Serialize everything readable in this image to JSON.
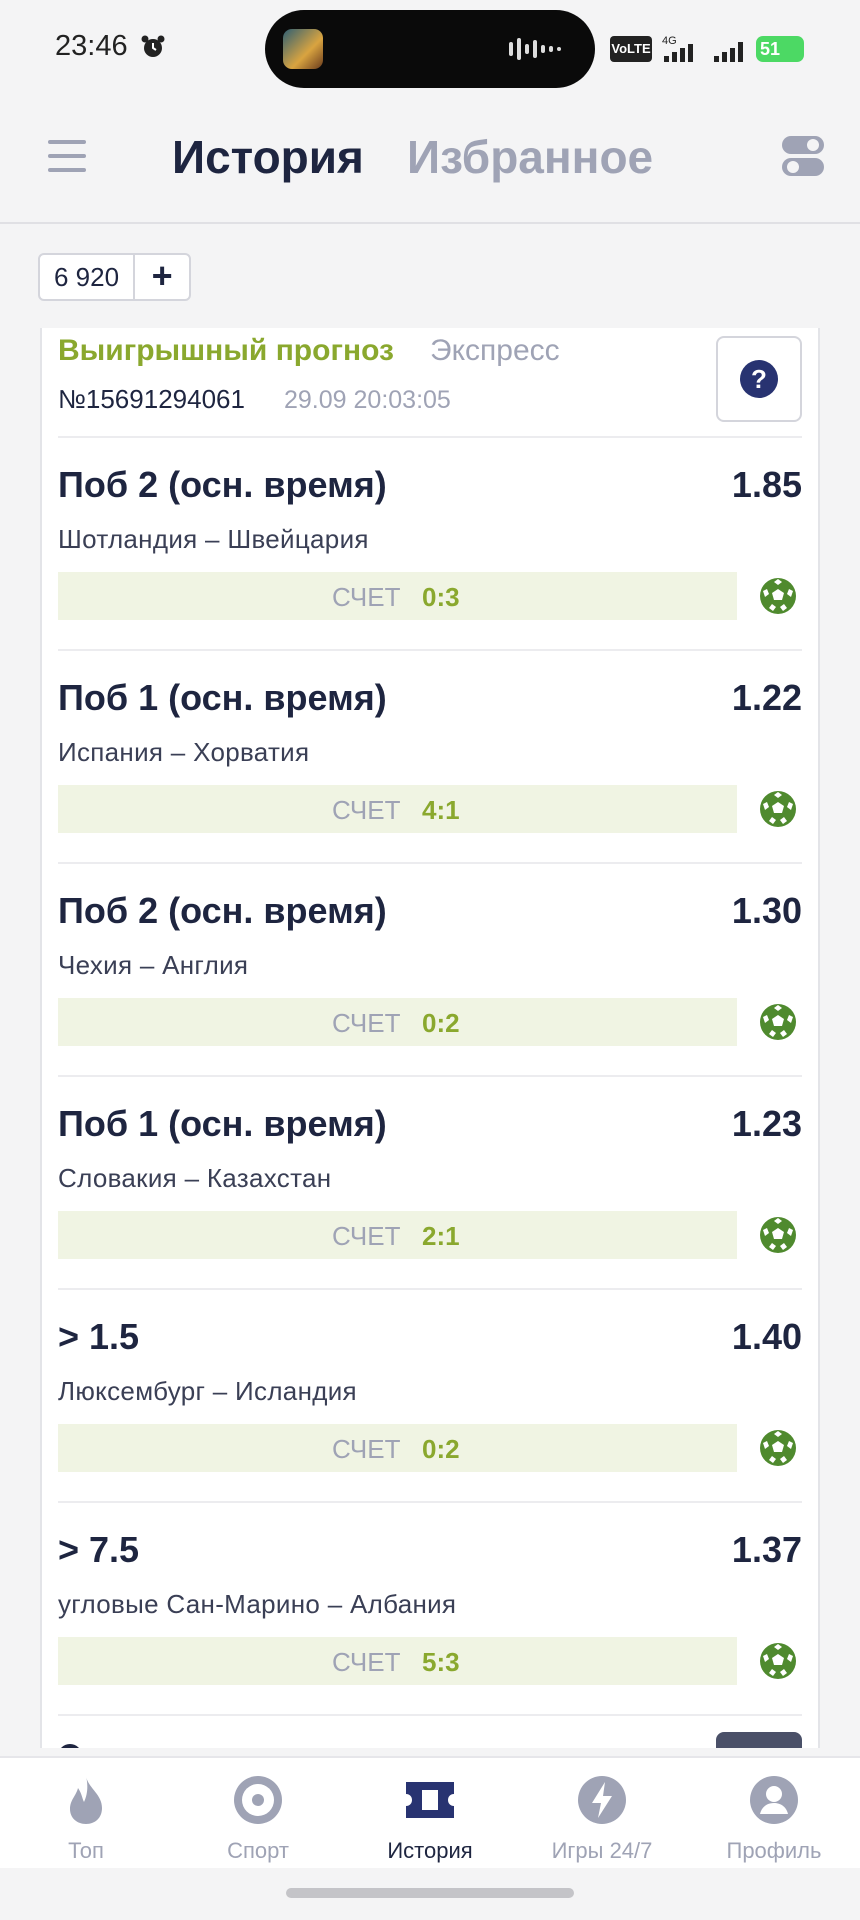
{
  "status_bar": {
    "time": "23:46",
    "volte": "VoLTE",
    "network": "4G",
    "battery": "51",
    "icons": [
      "alarm-icon",
      "voice-wave-icon",
      "signal-icon",
      "wifi-icon",
      "battery-icon"
    ]
  },
  "header": {
    "tab_history": "История",
    "tab_favorites": "Избранное",
    "menu_icon": "menu-icon",
    "settings_icon": "toggle-settings-icon"
  },
  "balance": {
    "value": "6 920",
    "add_label": "+"
  },
  "card": {
    "status": "Выигрышный прогноз",
    "type": "Экспресс",
    "number": "№15691294061",
    "date": "29.09 20:03:05",
    "help": "?",
    "score_label": "СЧЕТ",
    "bets": [
      {
        "market": "Поб 2 (осн. время)",
        "odds": "1.85",
        "match": "Шотландия – Швейцария",
        "score": "0:3"
      },
      {
        "market": "Поб 1 (осн. время)",
        "odds": "1.22",
        "match": "Испания – Хорватия",
        "score": "4:1"
      },
      {
        "market": "Поб 2 (осн. время)",
        "odds": "1.30",
        "match": "Чехия – Англия",
        "score": "0:2"
      },
      {
        "market": "Поб 1 (осн. время)",
        "odds": "1.23",
        "match": "Словакия – Казахстан",
        "score": "2:1"
      },
      {
        "market": "> 1.5",
        "odds": "1.40",
        "match": "Люксембург – Исландия",
        "score": "0:2"
      },
      {
        "market": "> 7.5",
        "odds": "1.37",
        "match": "угловые Сан-Марино – Албания",
        "score": "5:3"
      }
    ]
  },
  "bottom_nav": [
    {
      "label": "Топ",
      "icon": "flame-icon",
      "active": false
    },
    {
      "label": "Спорт",
      "icon": "target-icon",
      "active": false
    },
    {
      "label": "История",
      "icon": "ticket-icon",
      "active": true
    },
    {
      "label": "Игры 24/7",
      "icon": "lightning-icon",
      "active": false
    },
    {
      "label": "Профиль",
      "icon": "profile-icon",
      "active": false
    }
  ],
  "colors": {
    "accent_green": "#8aa82e",
    "dark_navy": "#1e2540",
    "muted": "#9fa3b5",
    "score_bg": "#f0f4e3"
  }
}
